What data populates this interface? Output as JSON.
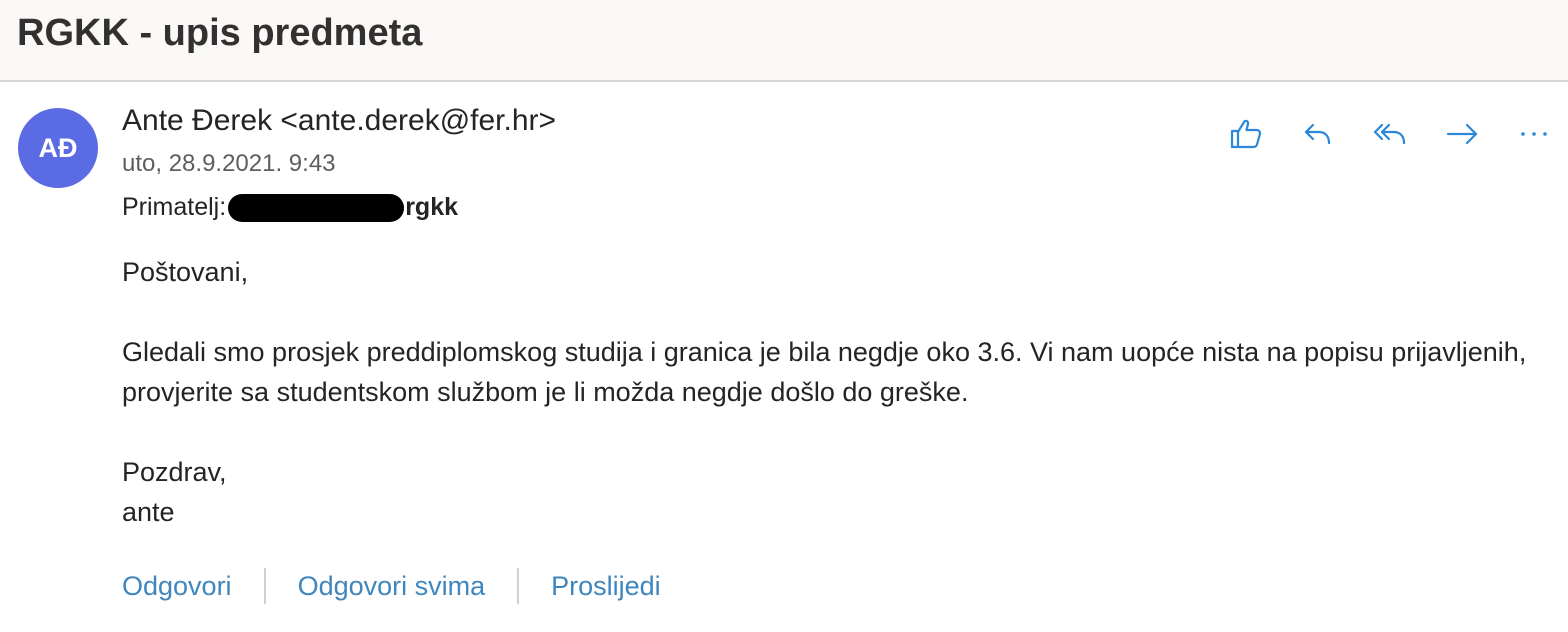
{
  "subject": "RGKK - upis predmeta",
  "sender": {
    "initials": "AĐ",
    "display": "Ante Đerek <ante.derek@fer.hr>",
    "date": "uto, 28.9.2021. 9:43"
  },
  "recipients": {
    "label": "Primatelj:",
    "name": "rgkk"
  },
  "toolbar": {
    "like_icon": "thumbs-up-icon",
    "reply_icon": "reply-icon",
    "reply_all_icon": "reply-all-icon",
    "forward_icon": "forward-icon",
    "more_icon": "more-icon"
  },
  "body": {
    "greeting": "Poštovani,",
    "paragraph": "Gledali smo prosjek preddiplomskog studija i granica je bila negdje oko 3.6. Vi nam uopće nista na popisu prijavljenih, provjerite sa studentskom službom je li možda negdje došlo do greške.",
    "closing": "Pozdrav,",
    "signature": "ante"
  },
  "footer": {
    "reply": "Odgovori",
    "reply_all": "Odgovori svima",
    "forward": "Proslijedi"
  },
  "colors": {
    "accent": "#3e86bd",
    "avatar": "#5b6be3",
    "icon": "#2b88d8"
  }
}
